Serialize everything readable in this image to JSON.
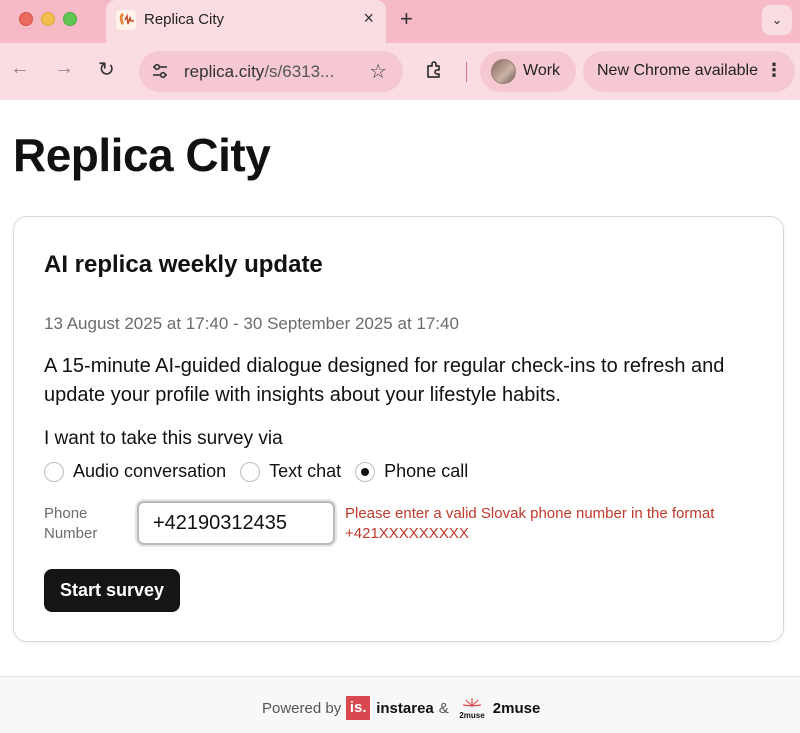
{
  "browser": {
    "tab_title": "Replica City",
    "tab_close": "×",
    "new_tab": "+",
    "tab_menu": "⌄",
    "url_host": "replica.city",
    "url_path": "/s/6313...",
    "profile_label": "Work",
    "update_label": "New Chrome available",
    "icons": [
      "back-arrow-icon",
      "forward-arrow-icon",
      "reload-icon",
      "site-info-icon",
      "star-icon",
      "extensions-icon",
      "kebab-menu-icon"
    ]
  },
  "page": {
    "title": "Replica City"
  },
  "survey": {
    "title": "AI replica weekly update",
    "dates": "13 August 2025 at 17:40 - 30 September 2025 at 17:40",
    "description": "A 15-minute AI-guided dialogue designed for regular check-ins to refresh and update your profile with insights about your lifestyle habits.",
    "via_label": "I want to take this survey via",
    "options": [
      {
        "label": "Audio conversation",
        "checked": false
      },
      {
        "label": "Text chat",
        "checked": false
      },
      {
        "label": "Phone call",
        "checked": true
      }
    ],
    "phone_label": "Phone Number",
    "phone_value": "+42190312435",
    "phone_error": "Please enter a valid Slovak phone number in the format +421XXXXXXXXX",
    "start_label": "Start survey"
  },
  "footer": {
    "powered_by": "Powered by",
    "brand1_logo": "is.",
    "brand1": "instarea",
    "amp": "&",
    "brand2_logo": "2muse",
    "brand2": "2muse"
  },
  "colors": {
    "chrome": "#f5bac6",
    "error": "#c0392b",
    "button": "#151515",
    "instarea": "#d9484f"
  }
}
